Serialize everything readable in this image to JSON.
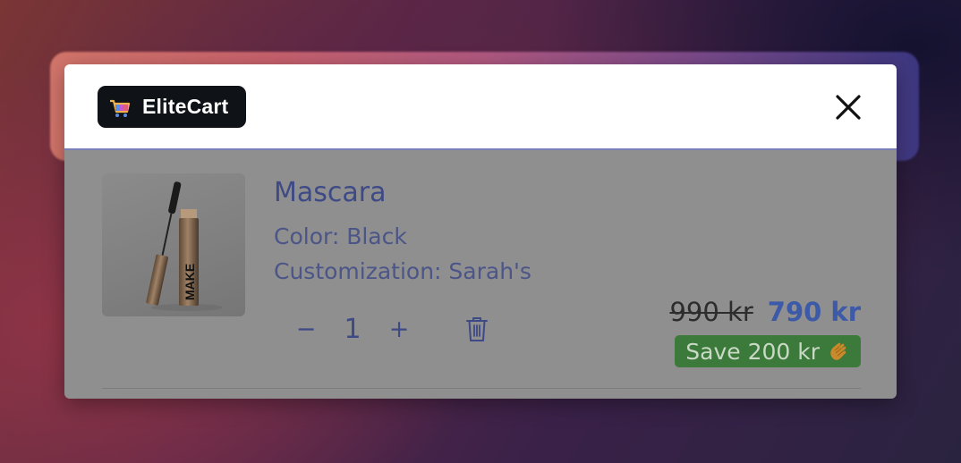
{
  "header": {
    "brand": "EliteCart",
    "logo_icon": "shopping-cart-icon",
    "close_icon": "close-icon"
  },
  "cart_item": {
    "image_icon": "mascara-product-image",
    "name": "Mascara",
    "color_label": "Color: Black",
    "customization_label": "Customization: Sarah's",
    "quantity": "1",
    "decrement": "−",
    "increment": "+",
    "delete_icon": "trash-icon",
    "original_price": "990 kr",
    "price": "790 kr",
    "savings": "Save 200 kr",
    "savings_icon": "clapping-hands-icon"
  },
  "colors": {
    "brand_bg": "#0f1217",
    "accent_text": "#3e4a86",
    "price": "#3d5aa8",
    "savings_bg": "#3b7a3a"
  }
}
